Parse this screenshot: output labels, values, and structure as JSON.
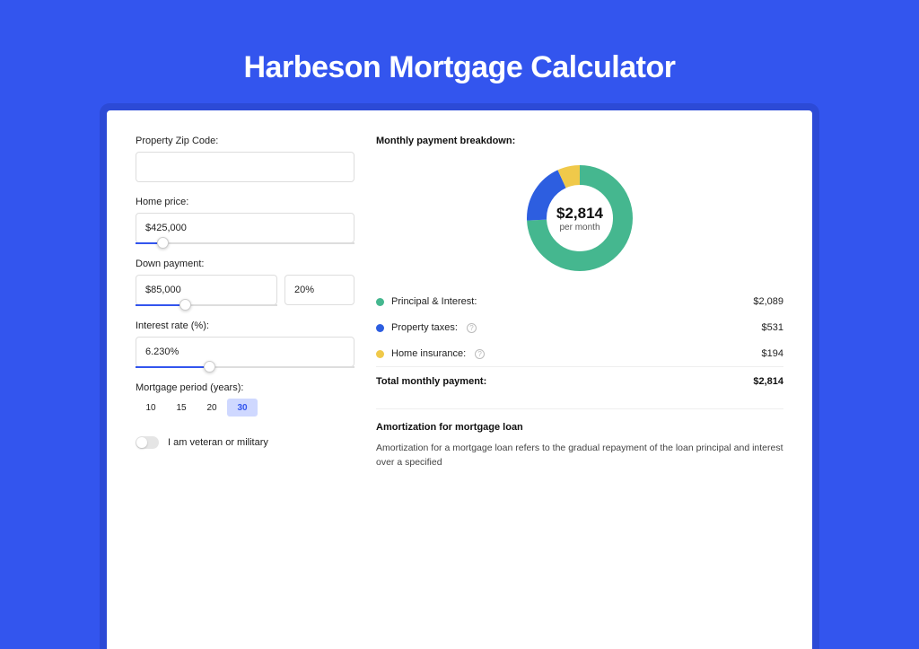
{
  "pageTitle": "Harbeson Mortgage Calculator",
  "form": {
    "zipLabel": "Property Zip Code:",
    "zipValue": "",
    "homePriceLabel": "Home price:",
    "homePriceValue": "$425,000",
    "downPaymentLabel": "Down payment:",
    "downPaymentValue": "$85,000",
    "downPaymentPct": "20%",
    "interestLabel": "Interest rate (%):",
    "interestValue": "6.230%",
    "periodLabel": "Mortgage period (years):",
    "periods": [
      "10",
      "15",
      "20",
      "30"
    ],
    "periodActive": "30",
    "veteranLabel": "I am veteran or military"
  },
  "breakdown": {
    "title": "Monthly payment breakdown:",
    "centerAmount": "$2,814",
    "centerSub": "per month",
    "items": [
      {
        "label": "Principal & Interest:",
        "value": "$2,089",
        "color": "pi"
      },
      {
        "label": "Property taxes:",
        "value": "$531",
        "color": "tax",
        "help": true
      },
      {
        "label": "Home insurance:",
        "value": "$194",
        "color": "ins",
        "help": true
      }
    ],
    "totalLabel": "Total monthly payment:",
    "totalValue": "$2,814"
  },
  "amort": {
    "title": "Amortization for mortgage loan",
    "text": "Amortization for a mortgage loan refers to the gradual repayment of the loan principal and interest over a specified"
  },
  "chart_data": {
    "type": "pie",
    "title": "Monthly payment breakdown",
    "series": [
      {
        "name": "Principal & Interest",
        "value": 2089,
        "color": "#45b78f"
      },
      {
        "name": "Property taxes",
        "value": 531,
        "color": "#2d5ee0"
      },
      {
        "name": "Home insurance",
        "value": 194,
        "color": "#f0c94a"
      }
    ],
    "total": 2814,
    "centerLabel": "$2,814 per month"
  }
}
